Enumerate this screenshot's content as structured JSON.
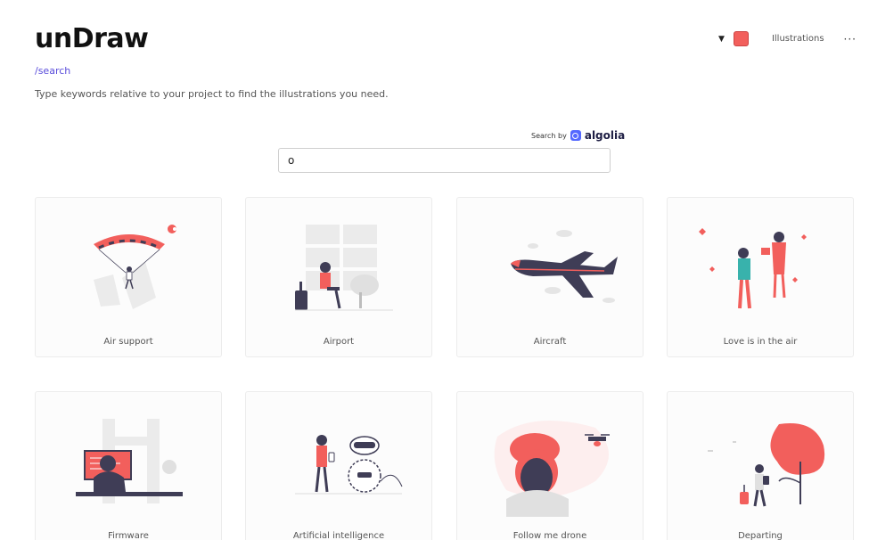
{
  "brand": {
    "logo_text": "unDraw"
  },
  "header": {
    "route": "/search",
    "tagline": "Type keywords relative to your project to find the illustrations you need.",
    "accent_color": "#f25f5c",
    "illustrations_link": "Illustrations",
    "more_icon": "ellipsis-icon",
    "caret_icon": "caret-down-icon"
  },
  "search": {
    "powered_by_label": "Search by",
    "powered_by_brand": "algolia",
    "value": "o",
    "placeholder": ""
  },
  "illustrations": [
    {
      "title": "Air support"
    },
    {
      "title": "Airport"
    },
    {
      "title": "Aircraft"
    },
    {
      "title": "Love is in the air"
    },
    {
      "title": "Firmware"
    },
    {
      "title": "Artificial intelligence"
    },
    {
      "title": "Follow me drone"
    },
    {
      "title": "Departing"
    }
  ]
}
